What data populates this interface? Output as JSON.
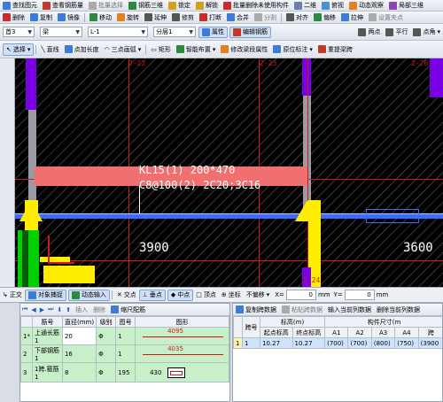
{
  "toolbar1": {
    "items": [
      "查找图元",
      "查看钢筋量",
      "批量选择",
      "钢筋三维",
      "锁定",
      "解锁",
      "批量删除未使用构件",
      "二维",
      "俯视",
      "动态观察",
      "局部三维"
    ]
  },
  "toolbar2": {
    "items": [
      "删除",
      "复制",
      "镜像",
      "移动",
      "旋转",
      "延伸",
      "修剪",
      "打断",
      "合并",
      "分割",
      "对齐",
      "偏移",
      "拉伸",
      "设置夹点"
    ]
  },
  "toolbar3": {
    "floor": "首3",
    "type": "梁",
    "name": "L-1",
    "layer": "分层1",
    "props_button": "属性",
    "edit_rebar_button": "编辑钢筋",
    "two_point": "两点",
    "parallel": "平行",
    "point_angle": "点角"
  },
  "toolbar4": {
    "items": [
      "选择",
      "直线",
      "点加长度",
      "三点画弧",
      "矩形",
      "智能布置",
      "修改梁段属性",
      "原位标注",
      "重提梁跨"
    ]
  },
  "canvas": {
    "axis_labels": [
      "2-22",
      "2-23",
      "2-26",
      "2-24"
    ],
    "beam_label": "KL15(1) 200*470",
    "stirrup_label": "C8@100(2) 2C20;3C16",
    "dim_left": "3900",
    "dim_right": "3600"
  },
  "statusbar": {
    "items": [
      "正交",
      "对象捕捉",
      "动态输入",
      "交点",
      "垂点",
      "中点",
      "顶点",
      "坐标",
      "不偏移"
    ],
    "x_label": "X=",
    "x_value": "0",
    "x_unit": "mm",
    "y_label": "Y=",
    "y_value": "0",
    "y_unit": "mm"
  },
  "rebar_panel": {
    "tools": [
      "插入",
      "删除",
      "缩尺配筋"
    ],
    "headers": [
      "筋号",
      "直径(mm)",
      "级别",
      "图号",
      "图形"
    ],
    "rows": [
      {
        "idx": "1*",
        "name": "上通长筋1",
        "diameter": "20",
        "grade": "Φ",
        "fig": "1",
        "shape": "4095"
      },
      {
        "idx": "2",
        "name": "下部钢筋1",
        "diameter": "16",
        "grade": "Φ",
        "fig": "1",
        "shape": "4035"
      },
      {
        "idx": "3",
        "name": "1跨.箍筋1",
        "diameter": "8",
        "grade": "Φ",
        "fig": "195",
        "shape": "430"
      }
    ]
  },
  "span_panel": {
    "tools": [
      "复制跨数据",
      "粘贴跨数据",
      "输入当前列数据",
      "删除当前列数据"
    ],
    "h_span": "跨号",
    "h_elev": "标高(m)",
    "h_size": "构件尺寸(m",
    "subheaders": [
      "起点标高",
      "终点标高",
      "A1",
      "A2",
      "A3",
      "A4",
      "跨"
    ],
    "rows": [
      {
        "idx": "1",
        "span": "1",
        "start": "10.27",
        "end": "10.27",
        "a1": "(700)",
        "a2": "(700)",
        "a3": "(800)",
        "a4": "(750)",
        "len": "(3900"
      }
    ]
  },
  "colors": {
    "beam_fill": "#f07070",
    "axis_blue": "#3a6cff",
    "column_yellow": "#ffee00",
    "wall_purple": "#7a00e6",
    "green": "#00d000",
    "grid_red": "#d01818"
  }
}
